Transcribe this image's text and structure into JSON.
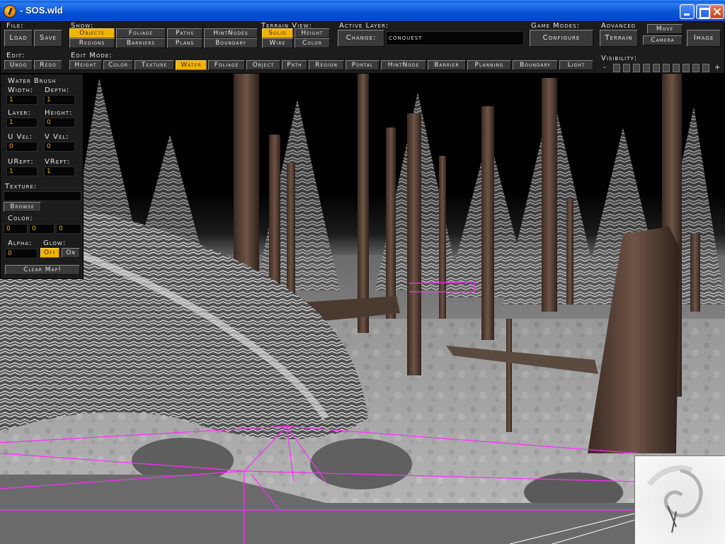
{
  "window": {
    "title": "- SOS.wld"
  },
  "file": {
    "label": "File:",
    "load": "Load",
    "save": "Save"
  },
  "edit": {
    "label": "Edit:",
    "undo": "Undo",
    "redo": "Redo"
  },
  "show": {
    "label": "Show:",
    "buttons": [
      "Objects",
      "Foliage",
      "Paths",
      "HintNodes",
      "Regions",
      "Barriers",
      "Plans",
      "Boundary"
    ],
    "active": "Objects"
  },
  "terrain_view": {
    "label": "Terrain View:",
    "buttons": [
      "Solid",
      "Height",
      "Wire",
      "Color"
    ],
    "active": "Solid"
  },
  "active_layer": {
    "label": "Active Layer:",
    "change": "Change:",
    "value": "conquest"
  },
  "game_modes": {
    "label": "Game Modes:",
    "configure": "Configure"
  },
  "advanced": {
    "label": "Advanced",
    "terrain": "Terrain",
    "move": "Move",
    "camera": "Camera",
    "image": "Image"
  },
  "visibility": {
    "label": "Visibility:",
    "minus": "-",
    "plus": "+",
    "boxes": 10
  },
  "edit_mode": {
    "label": "Edit Mode:",
    "buttons": [
      "Height",
      "Color",
      "Texture",
      "Water",
      "Foliage",
      "Object",
      "Path",
      "Region",
      "Portal",
      "HintNode",
      "Barrier",
      "Planning",
      "Boundary",
      "Light"
    ],
    "active": "Water"
  },
  "water_brush": {
    "title": "Water Brush",
    "width_label": "Width:",
    "width": "1",
    "depth_label": "Depth:",
    "depth": "1",
    "layer_label": "Layer:",
    "layer": "1",
    "height_label": "Height:",
    "height": "0",
    "uvel_label": "U Vel:",
    "uvel": "0",
    "vvel_label": "V Vel:",
    "vvel": "0",
    "urept_label": "URept:",
    "urept": "1",
    "vrept_label": "VRept:",
    "vrept": "1",
    "texture_label": "Texture:",
    "texture": "",
    "browse": "Browse",
    "color_label": "Color:",
    "color_r": "0",
    "color_g": "0",
    "color_b": "0",
    "alpha_label": "Alpha:",
    "alpha": "0",
    "glow_label": "Glow:",
    "glow_off": "Off",
    "glow_on": "On",
    "glow_active": "Off",
    "clear_map": "Clear Map!"
  },
  "colors": {
    "accent": "#f0b400",
    "wireframe": "#ff2cff",
    "panel": "#1c1c1c",
    "titlebar": "#0554d6"
  }
}
